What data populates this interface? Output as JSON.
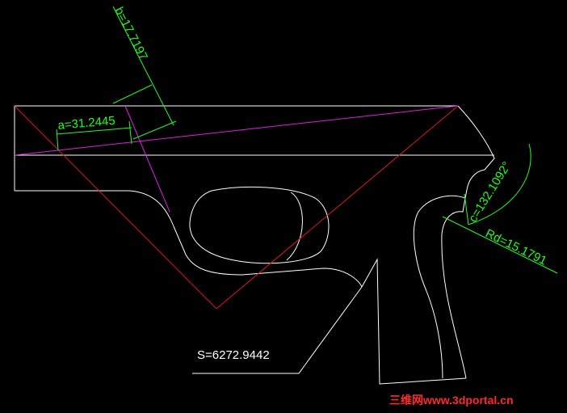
{
  "dimensions": {
    "a": "a=31.2445",
    "b": "b=17.7197",
    "c": "c=132.1092°",
    "rd": "Rd=15.1791"
  },
  "area_label": "S=6272.9442",
  "watermark": "三维网www.3dportal.cn",
  "colors": {
    "background": "#000000",
    "outline": "#ffffff",
    "dimension": "#1eff1e",
    "construction_red": "#e01818",
    "construction_magenta": "#e020e0",
    "watermark": "#ff2a2a"
  }
}
